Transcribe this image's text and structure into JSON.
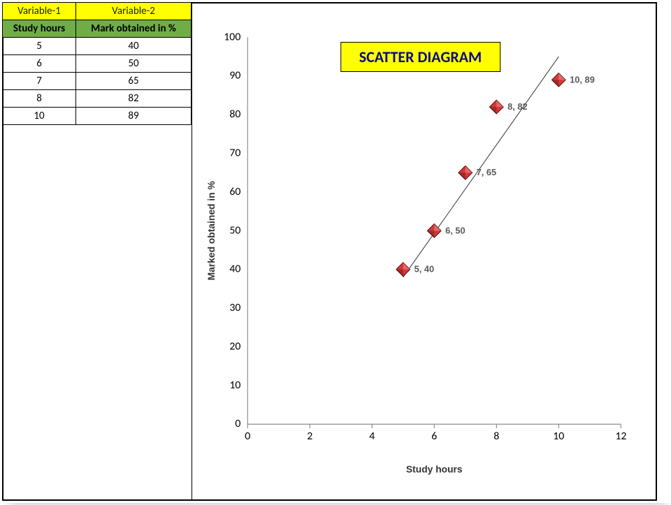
{
  "table": {
    "hdr1": [
      "Variable-1",
      "Variable-2"
    ],
    "hdr2": [
      "Study hours",
      "Mark obtained in %"
    ],
    "rows": [
      {
        "x": "5",
        "y": "40"
      },
      {
        "x": "6",
        "y": "50"
      },
      {
        "x": "7",
        "y": "65"
      },
      {
        "x": "8",
        "y": "82"
      },
      {
        "x": "10",
        "y": "89"
      }
    ]
  },
  "chart_data": {
    "type": "scatter",
    "title": "SCATTER DIAGRAM",
    "xlabel": "Study hours",
    "ylabel": "Marked obtained in %",
    "x": [
      5,
      6,
      7,
      8,
      10
    ],
    "y": [
      40,
      50,
      65,
      82,
      89
    ],
    "data_labels": [
      "5, 40",
      "6, 50",
      "7, 65",
      "8, 82",
      "10, 89"
    ],
    "xticks": [
      0,
      2,
      4,
      6,
      8,
      10,
      12
    ],
    "yticks": [
      0,
      10,
      20,
      30,
      40,
      50,
      60,
      70,
      80,
      90,
      100
    ],
    "xlim": [
      0,
      12
    ],
    "ylim": [
      0,
      100
    ],
    "trendline": {
      "x1": 5,
      "y1": 38,
      "x2": 10,
      "y2": 95
    },
    "colors": {
      "marker": "#d63737",
      "title_bg": "#ffff00",
      "title_fg": "#0a0a85"
    }
  }
}
